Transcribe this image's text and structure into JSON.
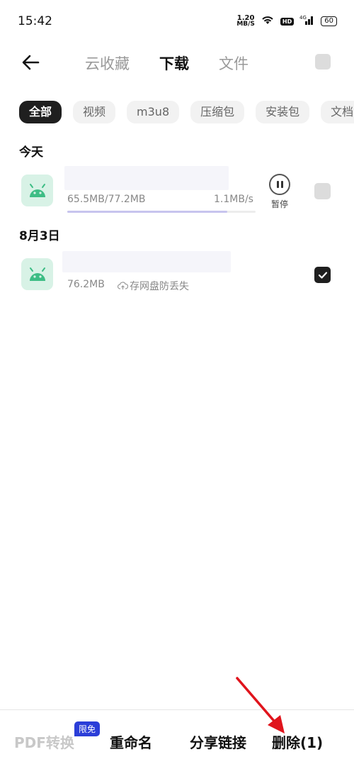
{
  "status": {
    "time": "15:42",
    "net_speed_value": "1.20",
    "net_speed_unit": "MB/S",
    "hd": "HD",
    "battery": "60"
  },
  "nav": {
    "tabs": [
      {
        "label": "云收藏",
        "active": false
      },
      {
        "label": "下载",
        "active": true
      },
      {
        "label": "文件",
        "active": false
      }
    ]
  },
  "filters": [
    {
      "label": "全部",
      "active": true
    },
    {
      "label": "视频",
      "active": false
    },
    {
      "label": "m3u8",
      "active": false
    },
    {
      "label": "压缩包",
      "active": false
    },
    {
      "label": "安装包",
      "active": false
    },
    {
      "label": "文档",
      "active": false
    }
  ],
  "sections": {
    "today": {
      "title": "今天",
      "item": {
        "size": "65.5MB/77.2MB",
        "speed": "1.1MB/s",
        "progress": 0.85,
        "pause_label": "暂停",
        "checked": false
      }
    },
    "aug3": {
      "title": "8月3日",
      "item": {
        "size": "76.2MB",
        "cloud_hint": "存网盘防丢失",
        "checked": true
      }
    }
  },
  "bottom": {
    "pdf": "PDF转换",
    "free_badge": "限免",
    "rename": "重命名",
    "share": "分享链接",
    "delete": "删除(1)"
  },
  "colors": {
    "accent_badge": "#2b3ed8",
    "annotation_arrow": "#e0141c",
    "progress": "#c7c4ee"
  }
}
